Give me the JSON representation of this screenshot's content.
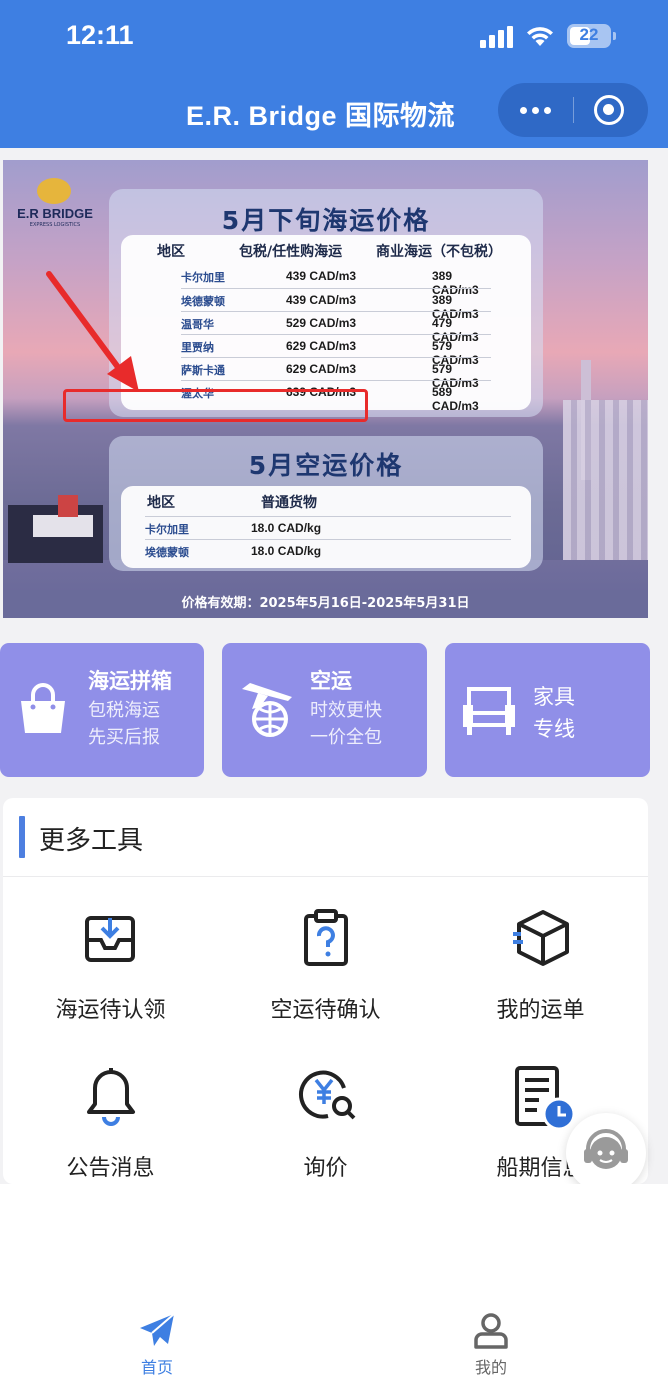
{
  "status_bar": {
    "time": "12:11",
    "battery": "22"
  },
  "header": {
    "title": "E.R. Bridge 国际物流"
  },
  "banner": {
    "logo_text": "E.R BRIDGE",
    "logo_sub": "EXPRESS LOGISTICS",
    "sea": {
      "title": "5月下旬海运价格",
      "headers": [
        "地区",
        "包税/任性购海运",
        "商业海运（不包税）"
      ],
      "rows": [
        {
          "region": "卡尔加里",
          "taxed": "439 CAD/m3",
          "commercial": "389 CAD/m3"
        },
        {
          "region": "埃德蒙顿",
          "taxed": "439 CAD/m3",
          "commercial": "389 CAD/m3"
        },
        {
          "region": "温哥华",
          "taxed": "529 CAD/m3",
          "commercial": "479 CAD/m3"
        },
        {
          "region": "里贾纳",
          "taxed": "629 CAD/m3",
          "commercial": "579 CAD/m3"
        },
        {
          "region": "萨斯卡通",
          "taxed": "629 CAD/m3",
          "commercial": "579 CAD/m3"
        },
        {
          "region": "渥太华",
          "taxed": "639 CAD/m3",
          "commercial": "589 CAD/m3"
        }
      ]
    },
    "air": {
      "title": "5月空运价格",
      "headers": [
        "地区",
        "普通货物"
      ],
      "rows": [
        {
          "region": "卡尔加里",
          "price": "18.0 CAD/kg"
        },
        {
          "region": "埃德蒙顿",
          "price": "18.0 CAD/kg"
        }
      ]
    },
    "validity": "价格有效期：2025年5月16日-2025年5月31日"
  },
  "categories": [
    {
      "title": "海运拼箱",
      "line1": "包税海运",
      "line2": "先买后报",
      "icon": "shopping-bag-icon"
    },
    {
      "title": "空运",
      "line1": "时效更快",
      "line2": "一价全包",
      "icon": "airplane-globe-icon"
    },
    {
      "title": "家具",
      "line1": "专线",
      "icon": "sofa-icon"
    }
  ],
  "tools": {
    "title": "更多工具",
    "items": [
      {
        "label": "海运待认领",
        "icon": "inbox-download-icon"
      },
      {
        "label": "空运待确认",
        "icon": "clipboard-question-icon"
      },
      {
        "label": "我的运单",
        "icon": "package-box-icon"
      },
      {
        "label": "公告消息",
        "icon": "bell-icon"
      },
      {
        "label": "询价",
        "icon": "yuan-search-icon"
      },
      {
        "label": "船期信息",
        "icon": "document-clock-icon"
      }
    ]
  },
  "tabbar": {
    "items": [
      {
        "label": "首页",
        "icon": "paper-plane-icon",
        "active": true
      },
      {
        "label": "我的",
        "icon": "user-icon",
        "active": false
      }
    ]
  },
  "colors": {
    "header_blue": "#3e7fe2",
    "card_purple": "#908fe8",
    "highlight_red": "#e82b2b",
    "tab_active": "#3e7fe2",
    "tab_inactive": "#666666"
  }
}
